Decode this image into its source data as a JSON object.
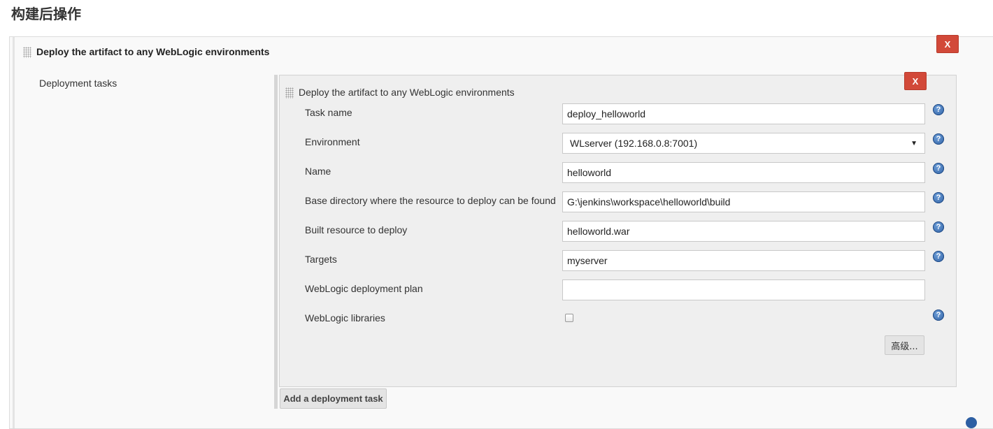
{
  "section_title": "构建后操作",
  "outer_step": {
    "title": "Deploy the artifact to any WebLogic environments",
    "delete_label": "X",
    "deployment_tasks_label": "Deployment tasks"
  },
  "task": {
    "title": "Deploy the artifact to any WebLogic environments",
    "delete_label": "X",
    "fields": {
      "task_name": {
        "label": "Task name",
        "value": "deploy_helloworld"
      },
      "environment": {
        "label": "Environment",
        "value": "WLserver (192.168.0.8:7001)"
      },
      "name": {
        "label": "Name",
        "value": "helloworld"
      },
      "base_dir": {
        "label": "Base directory where the resource to deploy can be found",
        "value": "G:\\jenkins\\workspace\\helloworld\\build"
      },
      "built_resource": {
        "label": "Built resource to deploy",
        "value": "helloworld.war"
      },
      "targets": {
        "label": "Targets",
        "value": "myserver"
      },
      "deployment_plan": {
        "label": "WebLogic deployment plan",
        "value": ""
      },
      "libraries": {
        "label": "WebLogic libraries",
        "checked": false
      }
    },
    "advanced_label": "高级..."
  },
  "add_task_label": "Add a deployment task",
  "help_glyph": "?",
  "icons": {
    "drag": "drag-handle-icon",
    "help": "help-icon",
    "dropdown": "chevron-down-icon"
  },
  "colors": {
    "delete_button": "#d24939",
    "help_icon": "#2d5fa3"
  }
}
